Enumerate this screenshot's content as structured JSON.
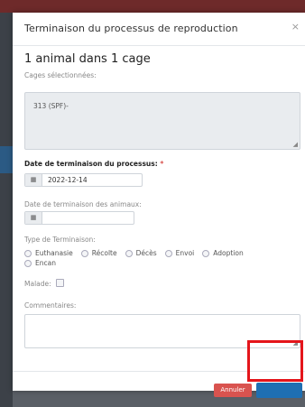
{
  "modal": {
    "title": "Terminaison du processus de reproduction",
    "close_label": "×"
  },
  "summary": {
    "heading": "1 animal dans 1 cage",
    "cages_label": "Cages sélectionnées:",
    "cages_value": "313 (SPF)-"
  },
  "process_date": {
    "label": "Date de terminaison du processus:",
    "required_mark": "*",
    "value": "2022-12-14",
    "icon": "calendar-icon"
  },
  "animals_date": {
    "label": "Date de terminaison des animaux:",
    "value": "",
    "icon": "calendar-icon"
  },
  "termination_type": {
    "label": "Type de Terminaison:",
    "options": [
      "Euthanasie",
      "Récolte",
      "Décès",
      "Envoi",
      "Adoption",
      "Encan"
    ]
  },
  "sick": {
    "label": "Malade:"
  },
  "comments": {
    "label": "Commentaires:"
  },
  "footer": {
    "cancel_label": "Annuler",
    "submit_color": "#1f6fb2",
    "cancel_color": "#d9534f",
    "highlight_color": "#e4151b"
  }
}
